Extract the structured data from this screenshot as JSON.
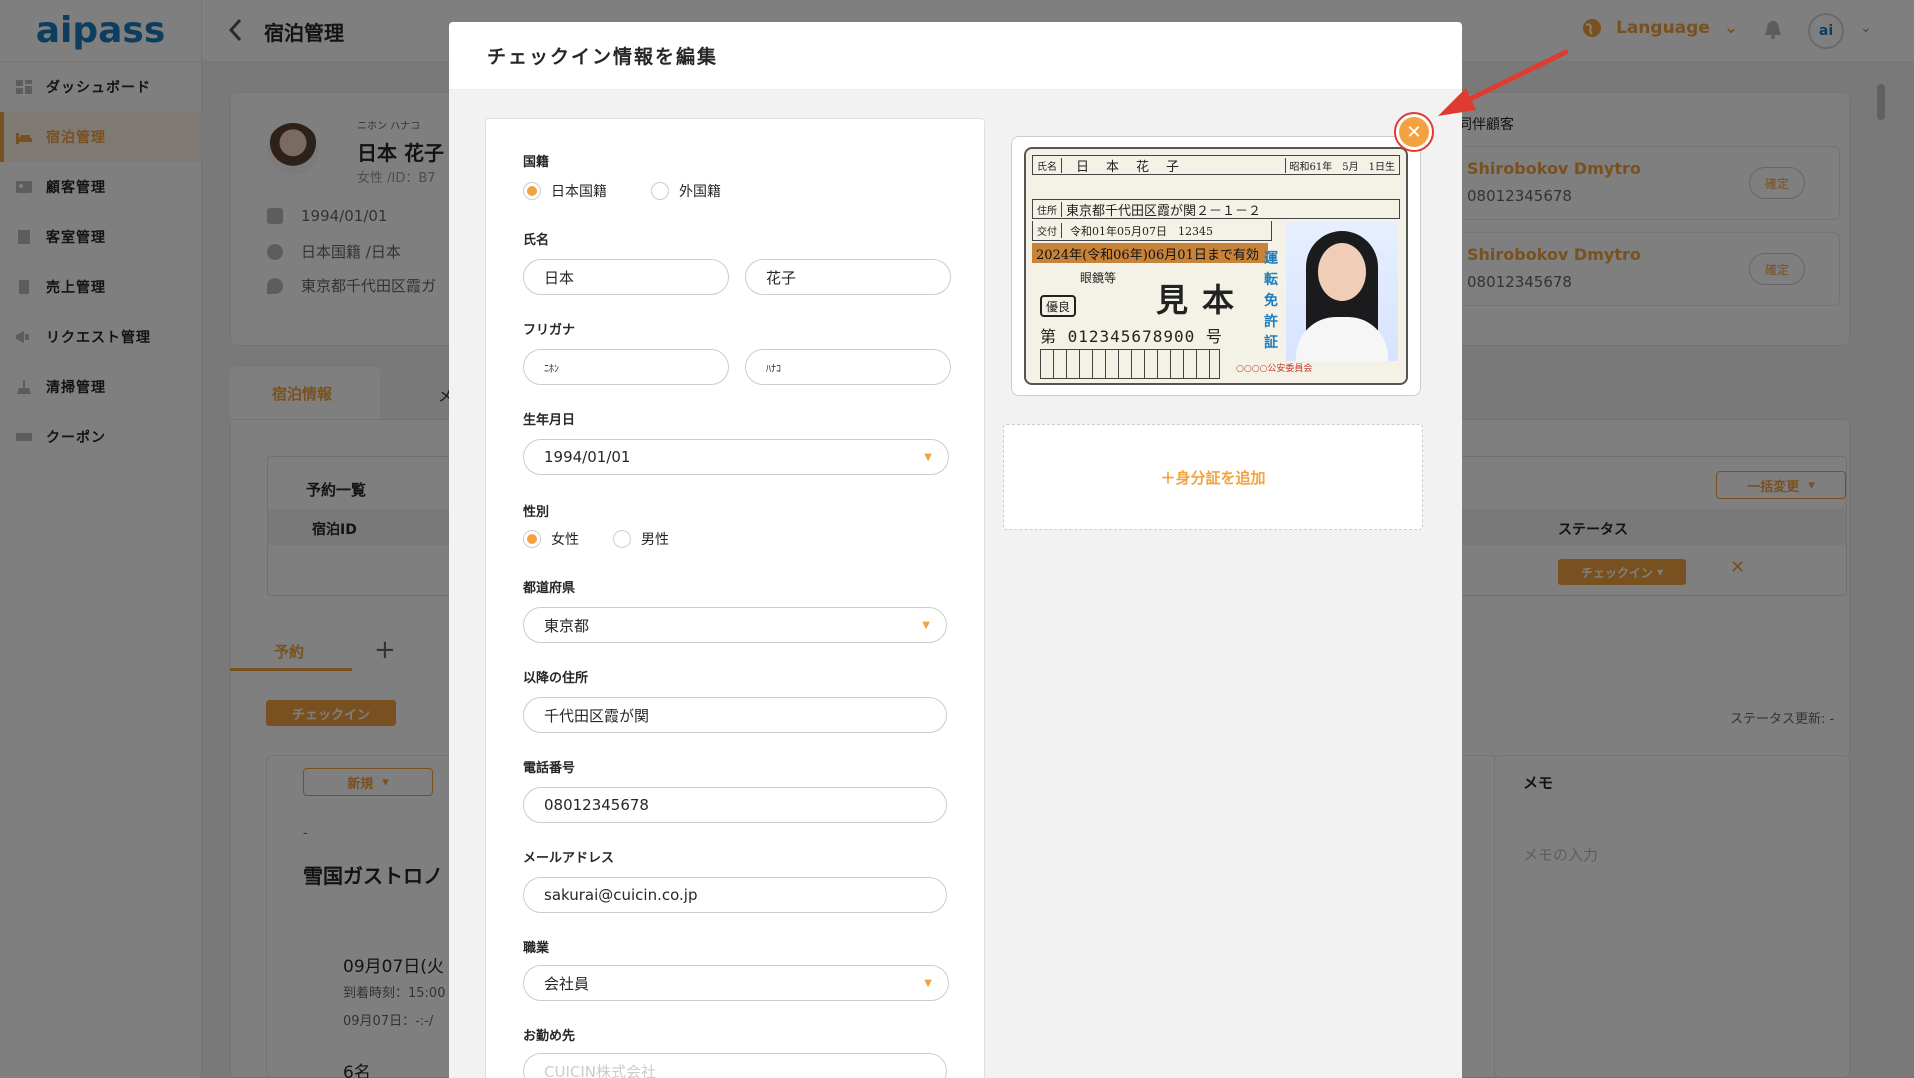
{
  "app": {
    "logo": "aipass",
    "page_title": "宿泊管理"
  },
  "header": {
    "language_label": "Language"
  },
  "sidebar": {
    "items": [
      {
        "label": "ダッシュボード",
        "icon": "dashboard-icon"
      },
      {
        "label": "宿泊管理",
        "icon": "bed-icon",
        "active": true
      },
      {
        "label": "顧客管理",
        "icon": "customer-icon"
      },
      {
        "label": "客室管理",
        "icon": "room-icon"
      },
      {
        "label": "売上管理",
        "icon": "sales-icon"
      },
      {
        "label": "リクエスト管理",
        "icon": "megaphone-icon"
      },
      {
        "label": "清掃管理",
        "icon": "cleaning-icon"
      },
      {
        "label": "クーポン",
        "icon": "coupon-icon"
      }
    ]
  },
  "guest": {
    "kana": "ニホン ハナコ",
    "name": "日本 花子",
    "sub": "女性 /ID：B7",
    "birthday": "1994/01/01",
    "nationality": "日本国籍 /日本",
    "address": "東京都千代田区霞ガ"
  },
  "companions": {
    "label": "同伴顧客",
    "items": [
      {
        "name": "Shirobokov Dmytro",
        "phone": "08012345678",
        "button": "確定"
      },
      {
        "name": "Shirobokov Dmytro",
        "phone": "08012345678",
        "button": "確定"
      }
    ]
  },
  "tabs": {
    "active": "宿泊情報",
    "other": "メ"
  },
  "reservations": {
    "title": "予約一覧",
    "col_id": "宿泊ID",
    "col_status": "ステータス",
    "bulk_label": "一括変更",
    "status_value": "チェックイン"
  },
  "subtabs": {
    "active": "予約",
    "add": "+"
  },
  "booking": {
    "checkin_badge": "チェックイン",
    "status_update": "ステータス更新: -",
    "new_select": "新規",
    "dash": "-",
    "name": "雪国ガストロノ",
    "date": "09月07日(火",
    "arrive": "到着時刻：15:00",
    "time": "09月07日：-:-/",
    "people": "6名"
  },
  "memo": {
    "title": "メモ",
    "placeholder": "メモの入力"
  },
  "modal": {
    "title": "チェックイン情報を編集",
    "nationality_label": "国籍",
    "nationality_options": [
      "日本国籍",
      "外国籍"
    ],
    "nationality_selected": "日本国籍",
    "name_label": "氏名",
    "last_name": "日本",
    "first_name": "花子",
    "furigana_label": "フリガナ",
    "last_kana": "ﾆﾎﾝ",
    "first_kana": "ﾊﾅｺ",
    "birthday_label": "生年月日",
    "birthday": "1994/01/01",
    "gender_label": "性別",
    "gender_options": [
      "女性",
      "男性"
    ],
    "gender_selected": "女性",
    "prefecture_label": "都道府県",
    "prefecture": "東京都",
    "address_label": "以降の住所",
    "address": "千代田区霞が関",
    "phone_label": "電話番号",
    "phone": "08012345678",
    "email_label": "メールアドレス",
    "email": "sakurai@cuicin.co.jp",
    "occupation_label": "職業",
    "occupation": "会社員",
    "company_label": "お勤め先",
    "company": "CUICIN株式会社",
    "add_id_label": "＋身分証を追加"
  },
  "id_card": {
    "name_label": "氏名",
    "name": "日　本　花　子",
    "birth": "昭和61年　5月　1日生",
    "address_label": "住所",
    "address": "東京都千代田区霞が関２－１－２",
    "issue_label": "交付",
    "issue": "令和01年05月07日　12345",
    "expiry": "2024年(令和06年)06月01日まで有効",
    "condition": "眼鏡等",
    "stamp": "優良",
    "specimen": "見本",
    "number": "第 012345678900 号",
    "vertical": "運転免許証",
    "authority": "○○○○公安委員会"
  },
  "colors": {
    "accent": "#f2a340",
    "brand": "#1a7bbf",
    "highlight_red": "#e03b30"
  }
}
